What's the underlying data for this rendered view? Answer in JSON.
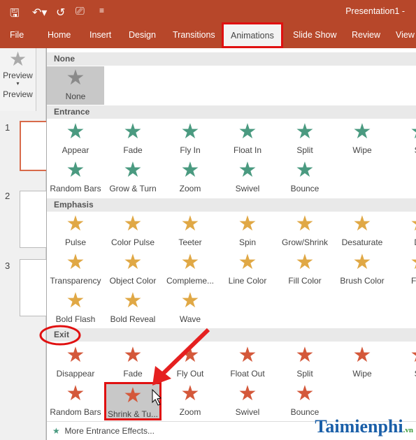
{
  "title": "Presentation1 -",
  "tabs": [
    "File",
    "Home",
    "Insert",
    "Design",
    "Transitions",
    "Animations",
    "Slide Show",
    "Review",
    "View"
  ],
  "active_tab": "Animations",
  "ribbon": {
    "button": "Preview",
    "group": "Preview"
  },
  "slides": [
    "1",
    "2",
    "3"
  ],
  "sections": [
    {
      "name": "None",
      "color": "#8a8a8a",
      "rows": [
        [
          "None"
        ]
      ]
    },
    {
      "name": "Entrance",
      "color": "#4a9a80",
      "rows": [
        [
          "Appear",
          "Fade",
          "Fly In",
          "Float In",
          "Split",
          "Wipe",
          "Sh"
        ],
        [
          "Random Bars",
          "Grow & Turn",
          "Zoom",
          "Swivel",
          "Bounce"
        ]
      ]
    },
    {
      "name": "Emphasis",
      "color": "#e0a845",
      "rows": [
        [
          "Pulse",
          "Color Pulse",
          "Teeter",
          "Spin",
          "Grow/Shrink",
          "Desaturate",
          "Da"
        ],
        [
          "Transparency",
          "Object Color",
          "Compleme...",
          "Line Color",
          "Fill Color",
          "Brush Color",
          "Font"
        ],
        [
          "Bold Flash",
          "Bold Reveal",
          "Wave"
        ]
      ]
    },
    {
      "name": "Exit",
      "color": "#d4583a",
      "rows": [
        [
          "Disappear",
          "Fade",
          "Fly Out",
          "Float Out",
          "Split",
          "Wipe",
          "Sh"
        ],
        [
          "Random Bars",
          "Shrink & Tu...",
          "Zoom",
          "Swivel",
          "Bounce"
        ]
      ]
    }
  ],
  "selected": "Shrink & Tu...",
  "more": "More Entrance Effects...",
  "watermark": "Taimienphi.vn"
}
